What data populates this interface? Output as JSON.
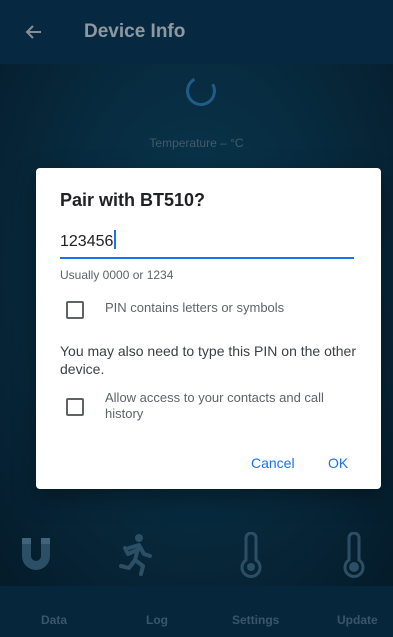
{
  "appbar": {
    "title": "Device Info",
    "back_icon": "arrow-back-icon"
  },
  "main": {
    "temperature_label": "Temperature  –  °C"
  },
  "feature_icons": [
    "magnet-icon",
    "running-person-icon",
    "thermometer-icon",
    "thermometer-icon"
  ],
  "bottom_nav": {
    "items": [
      {
        "label": "Data"
      },
      {
        "label": "Log"
      },
      {
        "label": "Settings"
      },
      {
        "label": "Update"
      }
    ]
  },
  "dialog": {
    "title": "Pair with BT510?",
    "pin_value": "123456",
    "hint": "Usually 0000 or 1234",
    "pin_letters_label": "PIN contains letters or symbols",
    "pin_letters_checked": false,
    "info_text": "You may also need to type this PIN on the other device.",
    "contacts_label": "Allow access to your contacts and call history",
    "contacts_checked": false,
    "cancel_label": "Cancel",
    "ok_label": "OK"
  },
  "colors": {
    "accent": "#1a73e8",
    "appbar": "#093a5a",
    "background": "#0b3146"
  }
}
